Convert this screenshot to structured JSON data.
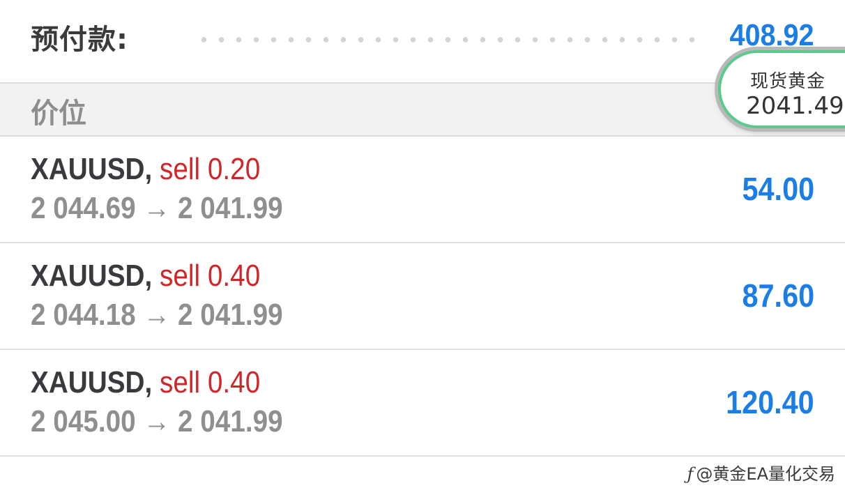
{
  "prepayment": {
    "label": "预付款:",
    "value": "408.92"
  },
  "section": {
    "title": "价位"
  },
  "quote_bubble": {
    "name": "现货黄金",
    "price": "2041.49"
  },
  "positions": [
    {
      "symbol": "XAUUSD,",
      "side_volume": "sell 0.20",
      "price_open": "2 044.69",
      "arrow": "→",
      "price_current": "2 041.99",
      "profit": "54.00"
    },
    {
      "symbol": "XAUUSD,",
      "side_volume": "sell 0.40",
      "price_open": "2 044.18",
      "arrow": "→",
      "price_current": "2 041.99",
      "profit": "87.60"
    },
    {
      "symbol": "XAUUSD,",
      "side_volume": "sell 0.40",
      "price_open": "2 045.00",
      "arrow": "→",
      "price_current": "2 041.99",
      "profit": "120.40"
    }
  ],
  "watermark": {
    "icon": "ƒ",
    "text": "@黄金EA量化交易"
  },
  "colors": {
    "profit_blue": "#1a7ee6",
    "sell_red": "#d0262a",
    "bubble_border_green": "#5ec98c",
    "secondary_gray": "#8f8f8f"
  },
  "icons": {
    "watermark_logo": "platform-logo-icon"
  }
}
